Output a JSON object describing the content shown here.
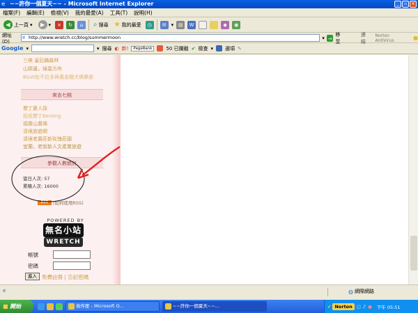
{
  "window": {
    "title": "~~許你一個夏天~~ - Microsoft Internet Explorer"
  },
  "menu": [
    "檔案(F)",
    "編輯(E)",
    "檢視(V)",
    "我的最愛(A)",
    "工具(T)",
    "說明(H)"
  ],
  "toolbar": {
    "back": "上一頁",
    "search": "搜尋",
    "favorites": "我的最愛"
  },
  "address": {
    "label": "網址(D)",
    "url": "http://www.wretch.cc/blog/summermoon",
    "go": "移至",
    "links": "連結",
    "norton": "Norton AntiVirus"
  },
  "google_bar": {
    "logo": "Google",
    "search": "搜尋",
    "new_label": "新!",
    "pagerank": "PageRank",
    "blocked": "50 已攔截",
    "check": "檢查",
    "options": "選項"
  },
  "sidebar": {
    "top_links": [
      "三峽 皇后鎮森林",
      "山那邊，綠葉方舟",
      "B&W扯不拉多與黃金獵犬俱樂部"
    ],
    "section_title": "來去七桃",
    "travel_links": [
      "墾丁夏人誌",
      "抵抵墾丁Kenting",
      "福壽山農場",
      "清境旅遊網",
      "清境老農莊新玫瑰莊園",
      "宜蘭，老街新人文產業旅遊"
    ],
    "stats_title": "參觀人數統計",
    "today": "當日人次: 57",
    "total": "累積人次: 16000",
    "rss_badge": "RSS",
    "rss_help": "(如何使用RSS)",
    "powered_by": "POWERED BY",
    "logo_top": "無名小站",
    "logo_bottom": "WRETCH",
    "account_label": "帳號",
    "password_label": "密碼",
    "enter_button": "進入",
    "register_link": "免費註冊 | 忘記密碼"
  },
  "status": {
    "zone": "網際網路"
  },
  "taskbar": {
    "start": "開始",
    "tasks": [
      "收件匣 - Microsoft O...",
      "~~許你一個夏天~~..."
    ],
    "norton": "Norton",
    "clock": "下午 05:51"
  },
  "colors": {
    "link": "#cc9e45",
    "annotation": "#e02020",
    "sidebar_bg": "#fdf0f0"
  }
}
